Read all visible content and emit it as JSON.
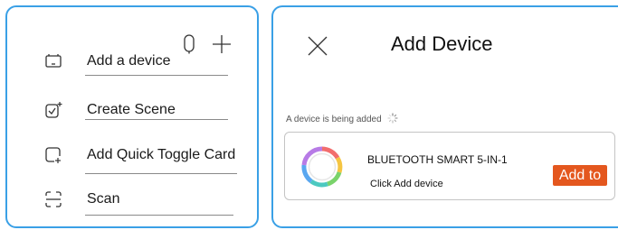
{
  "left_panel": {
    "icons": [
      "microphone-icon",
      "plus-icon"
    ],
    "items": [
      {
        "label": "Add a device",
        "icon": "add-device-icon"
      },
      {
        "label": "Create Scene",
        "icon": "create-scene-icon"
      },
      {
        "label": "Add Quick Toggle Card",
        "icon": "quick-toggle-card-icon"
      },
      {
        "label": "Scan",
        "icon": "scan-icon"
      }
    ]
  },
  "right_panel": {
    "title": "Add Device",
    "close_icon": "close-icon",
    "status_text": "A device is being added",
    "status_icon": "loading-spinner-icon",
    "device": {
      "name": "BLUETOOTH SMART 5-IN-1",
      "subtitle": "Click Add device",
      "button_label": "Add to",
      "icon": "rgb-ring-icon"
    }
  },
  "colors": {
    "panel_border": "#3aa0e6",
    "add_button": "#e4571e",
    "divider": "#8a8a8a"
  }
}
